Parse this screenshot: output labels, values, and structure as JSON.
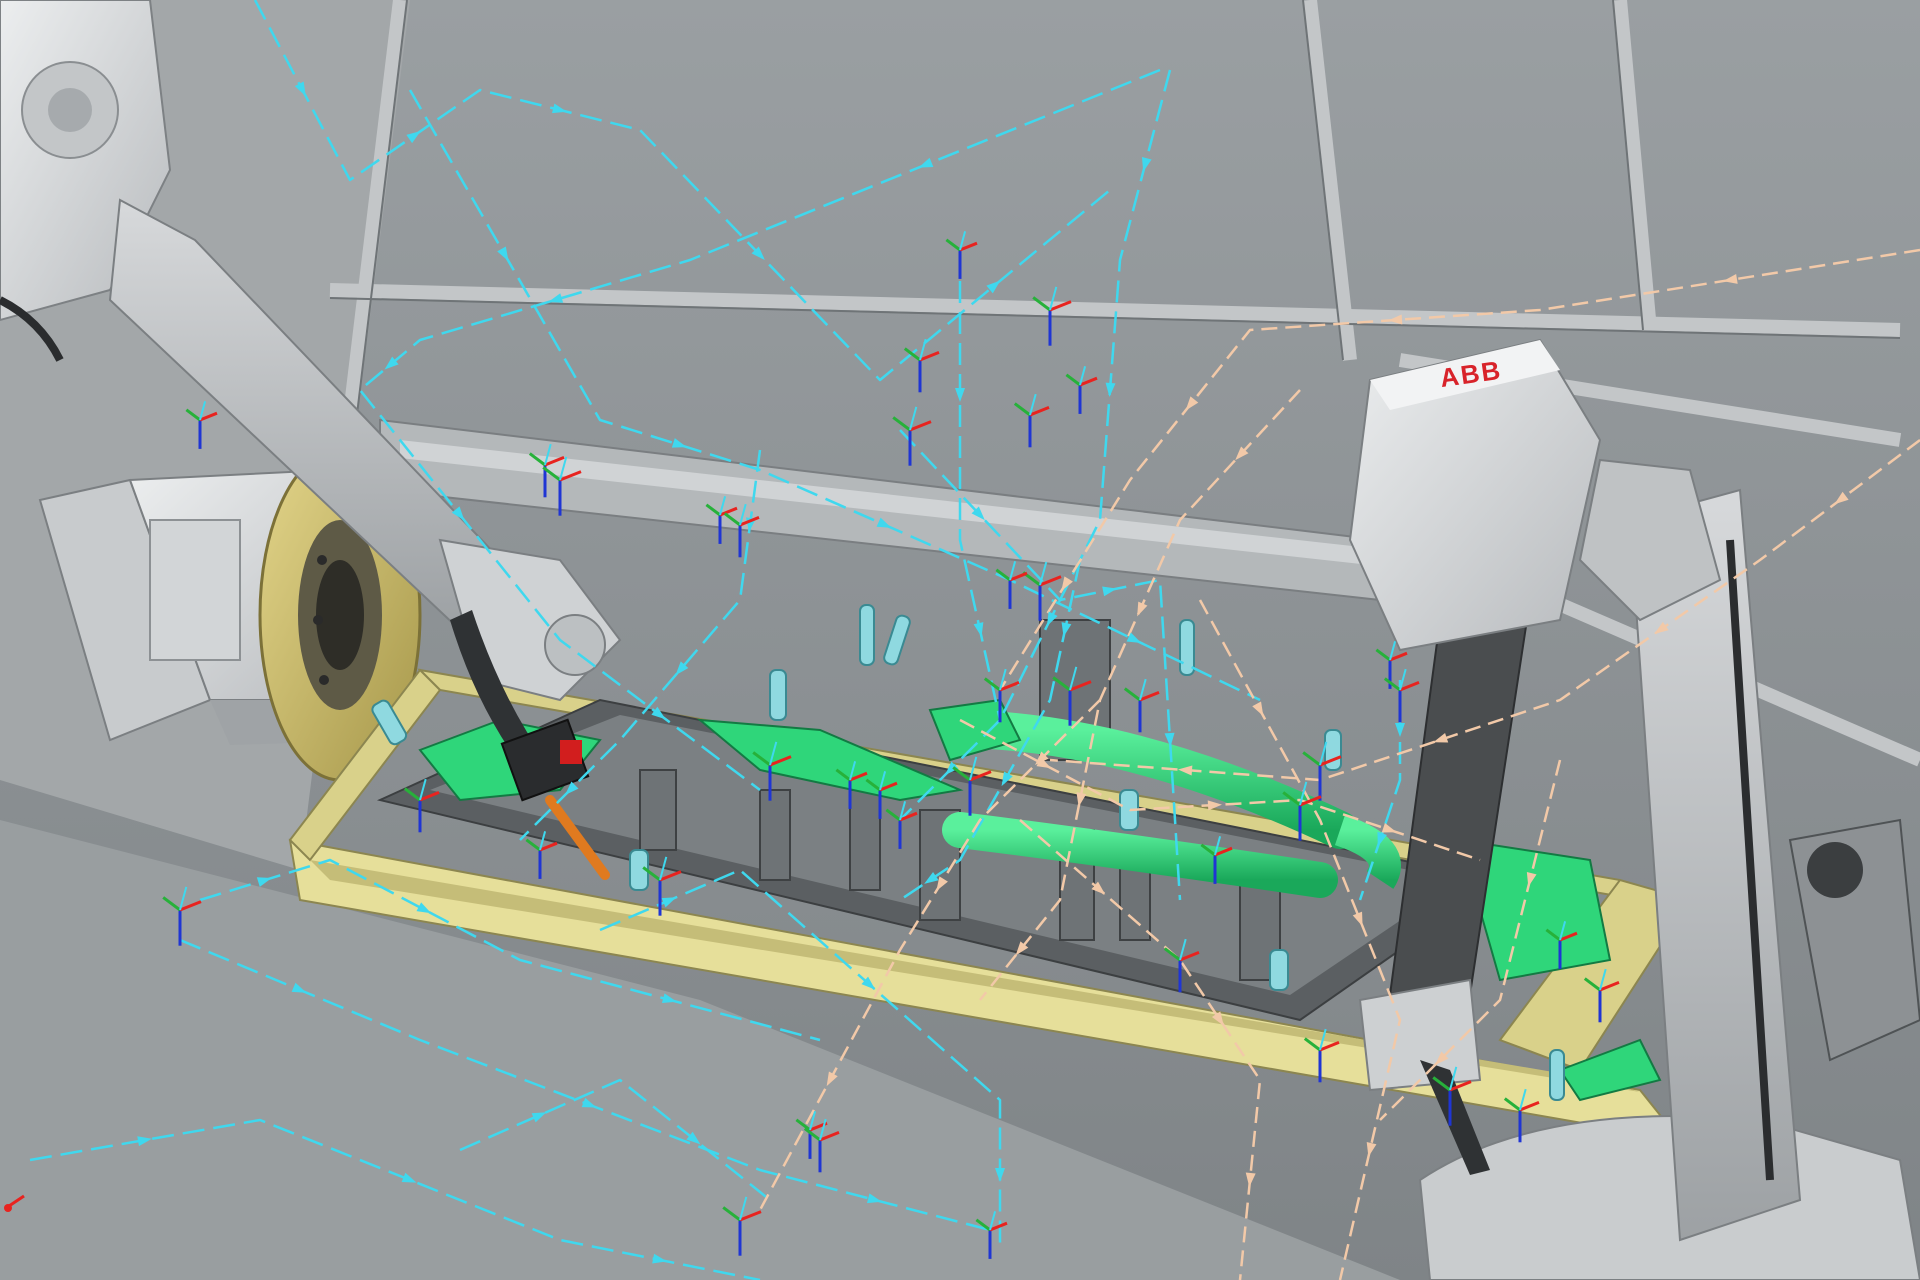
{
  "viewport": {
    "logo_text": "ABB"
  },
  "colors": {
    "background": "#8f9496",
    "wall": "#8b9093",
    "wall_frame": "#c9ccce",
    "robot_body": "#d9dbdd",
    "robot_shadow": "#a9acaf",
    "robot_dark": "#444749",
    "turntable": "#c9b86a",
    "base_frame": "#e6df9a",
    "fixture_part": "#2fd67a",
    "clamp": "#8fd9e0",
    "path_primary": "#3fd8ee",
    "path_secondary": "#f2c9a8",
    "axis_x": "#e8231f",
    "axis_y": "#27b13a",
    "axis_z": "#1f35d4",
    "brand_red": "#d8232a"
  },
  "icons": {
    "target_frame": "target-frame-icon",
    "world_axis": "world-axis-icon"
  }
}
